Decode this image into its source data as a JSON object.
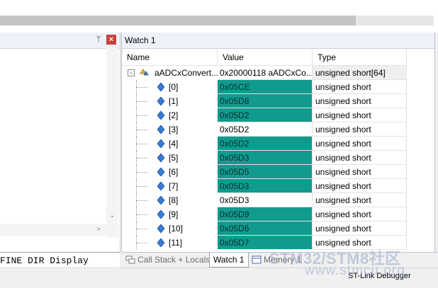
{
  "watch": {
    "title": "Watch 1",
    "columns": {
      "name": "Name",
      "value": "Value",
      "type": "Type"
    },
    "parent": {
      "name": "aADCxConvert...",
      "value": "0x20000118 aADCxCo...",
      "type": "unsigned short[64]"
    },
    "items": [
      {
        "index": "[0]",
        "value": "0x05CE",
        "type": "unsigned short",
        "changed": true
      },
      {
        "index": "[1]",
        "value": "0x05D8",
        "type": "unsigned short",
        "changed": true
      },
      {
        "index": "[2]",
        "value": "0x05D2",
        "type": "unsigned short",
        "changed": true
      },
      {
        "index": "[3]",
        "value": "0x05D2",
        "type": "unsigned short",
        "changed": false
      },
      {
        "index": "[4]",
        "value": "0x05D2",
        "type": "unsigned short",
        "changed": true
      },
      {
        "index": "[5]",
        "value": "0x05D3",
        "type": "unsigned short",
        "changed": true
      },
      {
        "index": "[6]",
        "value": "0x05D5",
        "type": "unsigned short",
        "changed": true
      },
      {
        "index": "[7]",
        "value": "0x05D3",
        "type": "unsigned short",
        "changed": true
      },
      {
        "index": "[8]",
        "value": "0x05D3",
        "type": "unsigned short",
        "changed": false
      },
      {
        "index": "[9]",
        "value": "0x05D9",
        "type": "unsigned short",
        "changed": true
      },
      {
        "index": "[10]",
        "value": "0x05D6",
        "type": "unsigned short",
        "changed": true
      },
      {
        "index": "[11]",
        "value": "0x05D7",
        "type": "unsigned short",
        "changed": true
      }
    ]
  },
  "tabs": {
    "call_stack": "Call Stack + Locals",
    "watch1": "Watch 1",
    "memory": "Memory 1"
  },
  "left": {
    "pin": "ᛘ",
    "close": "×",
    "command_text": "FINE DIR Display"
  },
  "status": {
    "debugger": "ST-Link Debugger"
  },
  "watermark": {
    "line1": "STM32/STM8社区",
    "line2": "www.stmcu.org"
  },
  "colors": {
    "changed_value_bg": "#119a8e",
    "panel_header": "#eef2f8"
  },
  "icons": {
    "parent": "variable-struct-icon",
    "element": "variable-diamond-icon",
    "call_stack": "call-stack-icon",
    "memory": "memory-icon"
  }
}
